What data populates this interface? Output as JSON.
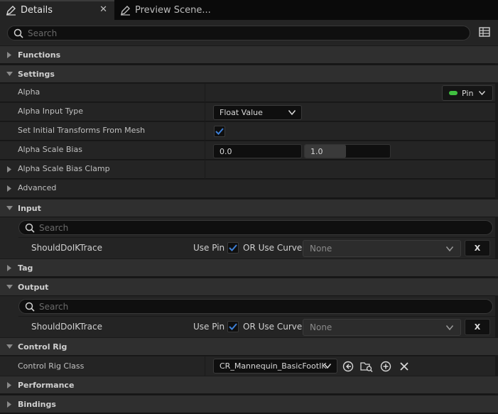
{
  "tabs": [
    {
      "label": "Details",
      "icon": "pencil-icon"
    },
    {
      "label": "Preview Scene...",
      "icon": "pencil-icon"
    }
  ],
  "tab_close": "✕",
  "search": {
    "placeholder": "Search"
  },
  "categories": {
    "functions": "Functions",
    "settings": "Settings",
    "advanced": "Advanced",
    "input": "Input",
    "tag": "Tag",
    "output": "Output",
    "control_rig": "Control Rig",
    "performance": "Performance",
    "bindings": "Bindings"
  },
  "settings": {
    "alpha": {
      "label": "Alpha",
      "pin_label": "Pin",
      "pin_color": "#40c040"
    },
    "alpha_input_type": {
      "label": "Alpha Input Type",
      "value": "Float Value"
    },
    "set_initial": {
      "label": "Set Initial Transforms From Mesh",
      "checked": true
    },
    "alpha_scale_bias": {
      "label": "Alpha Scale Bias",
      "min": "0.0",
      "max": "1.0"
    },
    "alpha_scale_bias_clamp": {
      "label": "Alpha Scale Bias Clamp"
    }
  },
  "input": {
    "search_placeholder": "Search",
    "row": {
      "name": "ShouldDoIKTrace",
      "use_pin": "Use Pin",
      "use_pin_checked": true,
      "or_use_curve": "OR Use Curve",
      "curve_value": "None",
      "clear": "X"
    }
  },
  "output": {
    "search_placeholder": "Search",
    "row": {
      "name": "ShouldDoIKTrace",
      "use_pin": "Use Pin",
      "use_pin_checked": true,
      "or_use_curve": "OR Use Curve",
      "curve_value": "None",
      "clear": "X"
    }
  },
  "control_rig": {
    "label": "Control Rig Class",
    "value": "CR_Mannequin_BasicFootIK"
  },
  "colors": {
    "accent_check": "#3d7fd6",
    "pin_green": "#40c040"
  }
}
